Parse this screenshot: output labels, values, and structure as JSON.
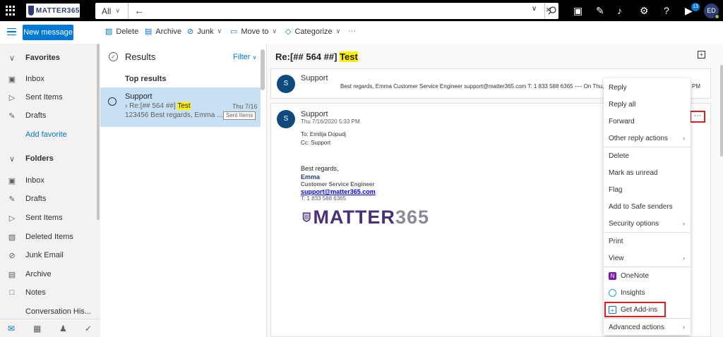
{
  "topbar": {
    "logo_text": "MATTER365",
    "search_scope": "All",
    "notification_badge": "13",
    "avatar_initials": "ED"
  },
  "commands": {
    "new_message": "New message",
    "delete": "Delete",
    "archive": "Archive",
    "junk": "Junk",
    "move_to": "Move to",
    "categorize": "Categorize",
    "more": "···"
  },
  "sidebar": {
    "favorites_label": "Favorites",
    "favorites": [
      {
        "label": "Inbox"
      },
      {
        "label": "Sent Items"
      },
      {
        "label": "Drafts"
      }
    ],
    "add_favorite": "Add favorite",
    "folders_label": "Folders",
    "folders": [
      {
        "label": "Inbox"
      },
      {
        "label": "Drafts"
      },
      {
        "label": "Sent Items"
      },
      {
        "label": "Deleted Items"
      },
      {
        "label": "Junk Email"
      },
      {
        "label": "Archive"
      },
      {
        "label": "Notes"
      },
      {
        "label": "Conversation His..."
      }
    ]
  },
  "message_list": {
    "title": "Results",
    "filter": "Filter",
    "section": "Top results",
    "item": {
      "from": "Support",
      "subject_prefix": "Re:[## 564 ##] ",
      "subject_highlight": "Test",
      "date": "Thu 7/16",
      "preview": "123456 Best regards, Emma ...",
      "folder": "Sent Items"
    }
  },
  "reading": {
    "subject_prefix": "Re:[## 564 ##] ",
    "subject_highlight": "Test",
    "collapsed": {
      "from": "Support",
      "avatar": "S",
      "preview": "Best regards, Emma Customer Service Engineer support@matter365.com T: 1 833 588 6365 ---- On Thu, 7/16",
      "time_suffix": "PM"
    },
    "expanded": {
      "from": "Support",
      "avatar": "S",
      "date": "Thu 7/16/2020 5:33 PM",
      "to": "To:  Emilija Dopudj",
      "cc": "Cc:  Support",
      "body": {
        "regards": "Best regards,",
        "name": "Emma",
        "role": "Customer Service Engineer",
        "email": "support@matter365.com",
        "phone": "T: 1 833 588 6365",
        "logo_word": "MATTER",
        "logo_digits": "365"
      }
    }
  },
  "context_menu": {
    "items": [
      {
        "label": "Reply"
      },
      {
        "label": "Reply all"
      },
      {
        "label": "Forward"
      },
      {
        "label": "Other reply actions"
      },
      {
        "label": "Delete"
      },
      {
        "label": "Mark as unread"
      },
      {
        "label": "Flag"
      },
      {
        "label": "Add to Safe senders"
      },
      {
        "label": "Security options"
      },
      {
        "label": "Print"
      },
      {
        "label": "View"
      },
      {
        "label": "OneNote"
      },
      {
        "label": "Insights"
      },
      {
        "label": "Get Add-ins"
      },
      {
        "label": "Advanced actions"
      }
    ]
  },
  "colors": {
    "accent": "#0078d4",
    "highlight": "#fff100",
    "annotation": "#e02020",
    "brand": "#2f3d73"
  }
}
